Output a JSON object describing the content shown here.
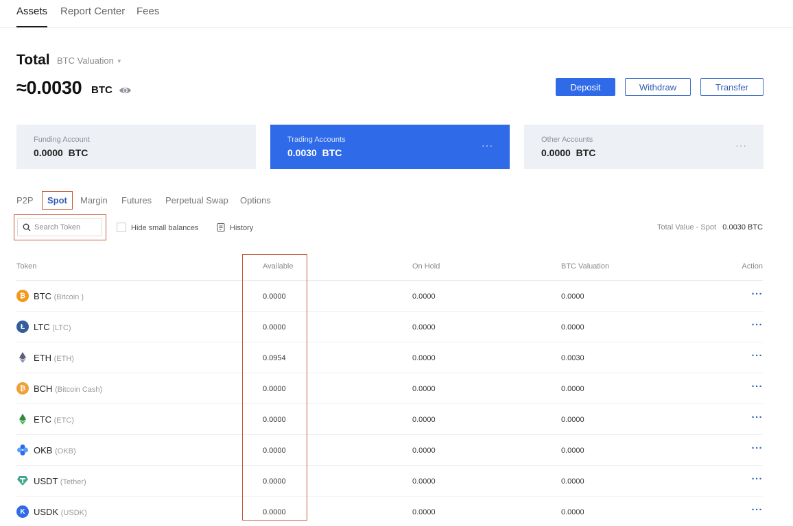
{
  "nav": {
    "tabs": [
      "Assets",
      "Report Center",
      "Fees"
    ]
  },
  "summary": {
    "title": "Total",
    "valuation_label": "BTC Valuation",
    "balance": "≈0.0030",
    "balance_unit": "BTC",
    "buttons": {
      "deposit": "Deposit",
      "withdraw": "Withdraw",
      "transfer": "Transfer"
    }
  },
  "accounts": [
    {
      "label": "Funding Account",
      "value": "0.0000  BTC"
    },
    {
      "label": "Trading Accounts",
      "value": "0.0030  BTC",
      "more": "···"
    },
    {
      "label": "Other Accounts",
      "value": "0.0000  BTC",
      "more": "···"
    }
  ],
  "subtabs": [
    "P2P",
    "Spot",
    "Margin",
    "Futures",
    "Perpetual Swap",
    "Options"
  ],
  "toolbar": {
    "search_placeholder": "Search Token",
    "hide_small": "Hide small balances",
    "history": "History",
    "total_value_label": "Total Value - Spot",
    "total_value": "0.0030 BTC"
  },
  "table": {
    "headers": {
      "token": "Token",
      "available": "Available",
      "on_hold": "On Hold",
      "btc_valuation": "BTC Valuation",
      "action": "Action"
    },
    "rows": [
      {
        "symbol": "BTC",
        "name": "(Bitcoin )",
        "available": "0.0000",
        "on_hold": "0.0000",
        "btc_valuation": "0.0000",
        "action": "···"
      },
      {
        "symbol": "LTC",
        "name": "(LTC)",
        "available": "0.0000",
        "on_hold": "0.0000",
        "btc_valuation": "0.0000",
        "action": "···"
      },
      {
        "symbol": "ETH",
        "name": "(ETH)",
        "available": "0.0954",
        "on_hold": "0.0000",
        "btc_valuation": "0.0030",
        "action": "···"
      },
      {
        "symbol": "BCH",
        "name": "(Bitcoin Cash)",
        "available": "0.0000",
        "on_hold": "0.0000",
        "btc_valuation": "0.0000",
        "action": "···"
      },
      {
        "symbol": "ETC",
        "name": "(ETC)",
        "available": "0.0000",
        "on_hold": "0.0000",
        "btc_valuation": "0.0000",
        "action": "···"
      },
      {
        "symbol": "OKB",
        "name": "(OKB)",
        "available": "0.0000",
        "on_hold": "0.0000",
        "btc_valuation": "0.0000",
        "action": "···"
      },
      {
        "symbol": "USDT",
        "name": "(Tether)",
        "available": "0.0000",
        "on_hold": "0.0000",
        "btc_valuation": "0.0000",
        "action": "···"
      },
      {
        "symbol": "USDK",
        "name": "(USDK)",
        "available": "0.0000",
        "on_hold": "0.0000",
        "btc_valuation": "0.0000",
        "action": "···"
      }
    ]
  },
  "colors": {
    "accent": "#2f6ae8",
    "link": "#2f5db5",
    "highlight": "#c05a3a",
    "account_bg": "#edf0f4"
  },
  "icons": {
    "btc": "bitcoin-icon",
    "ltc": "litecoin-icon",
    "eth": "ethereum-icon",
    "bch": "bitcoin-cash-icon",
    "etc": "ethereum-classic-icon",
    "okb": "okb-icon",
    "usdt": "tether-icon",
    "usdk": "usdk-icon"
  }
}
